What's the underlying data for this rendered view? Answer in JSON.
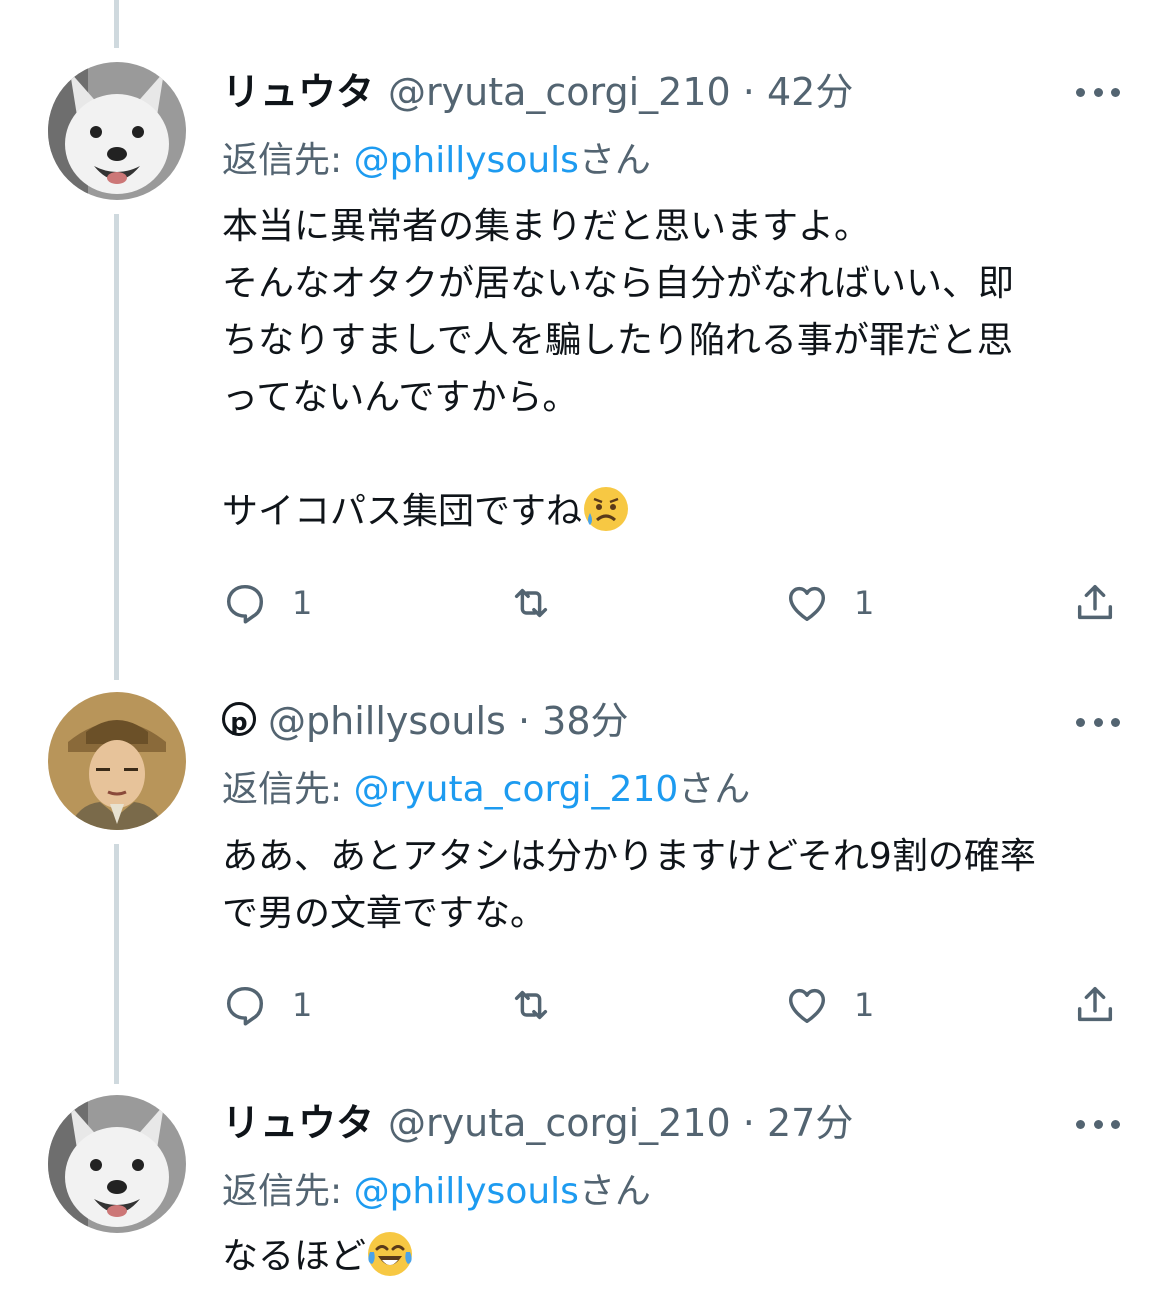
{
  "tweets": [
    {
      "display_name": "リュウタ",
      "handle": "@ryuta_corgi_210",
      "sep": "·",
      "time": "42分",
      "reply_prefix": "返信先: ",
      "reply_mention": "@phillysouls",
      "reply_suffix": "さん",
      "body": "本当に異常者の集まりだと思いますよ。\nそんなオタクが居ないなら自分がなればいい、即\nちなりすましで人を騙したり陥れる事が罪だと思\nってないんですから。\n\nサイコパス集団ですね",
      "body_emoji": "sad-sweat-emoji",
      "reply_count": "1",
      "like_count": "1",
      "avatar": "corgi-avatar"
    },
    {
      "display_name": "",
      "verified_glyph": "p",
      "handle": "@phillysouls",
      "sep": "·",
      "time": "38分",
      "reply_prefix": "返信先: ",
      "reply_mention": "@ryuta_corgi_210",
      "reply_suffix": "さん",
      "body": "ああ、あとアタシは分かりますけどそれ9割の確率\nで男の文章ですな。",
      "reply_count": "1",
      "like_count": "1",
      "avatar": "man-in-hat-avatar"
    },
    {
      "display_name": "リュウタ",
      "handle": "@ryuta_corgi_210",
      "sep": "·",
      "time": "27分",
      "reply_prefix": "返信先: ",
      "reply_mention": "@phillysouls",
      "reply_suffix": "さん",
      "body": "なるほど",
      "body_emoji": "tears-of-joy-emoji",
      "avatar": "corgi-avatar"
    }
  ],
  "colors": {
    "text": "#0f1419",
    "secondary": "#536471",
    "link": "#1d9bf0",
    "thread_line": "#cfd9de"
  },
  "icons": [
    "reply-icon",
    "retweet-icon",
    "like-icon",
    "share-icon",
    "more-icon"
  ]
}
